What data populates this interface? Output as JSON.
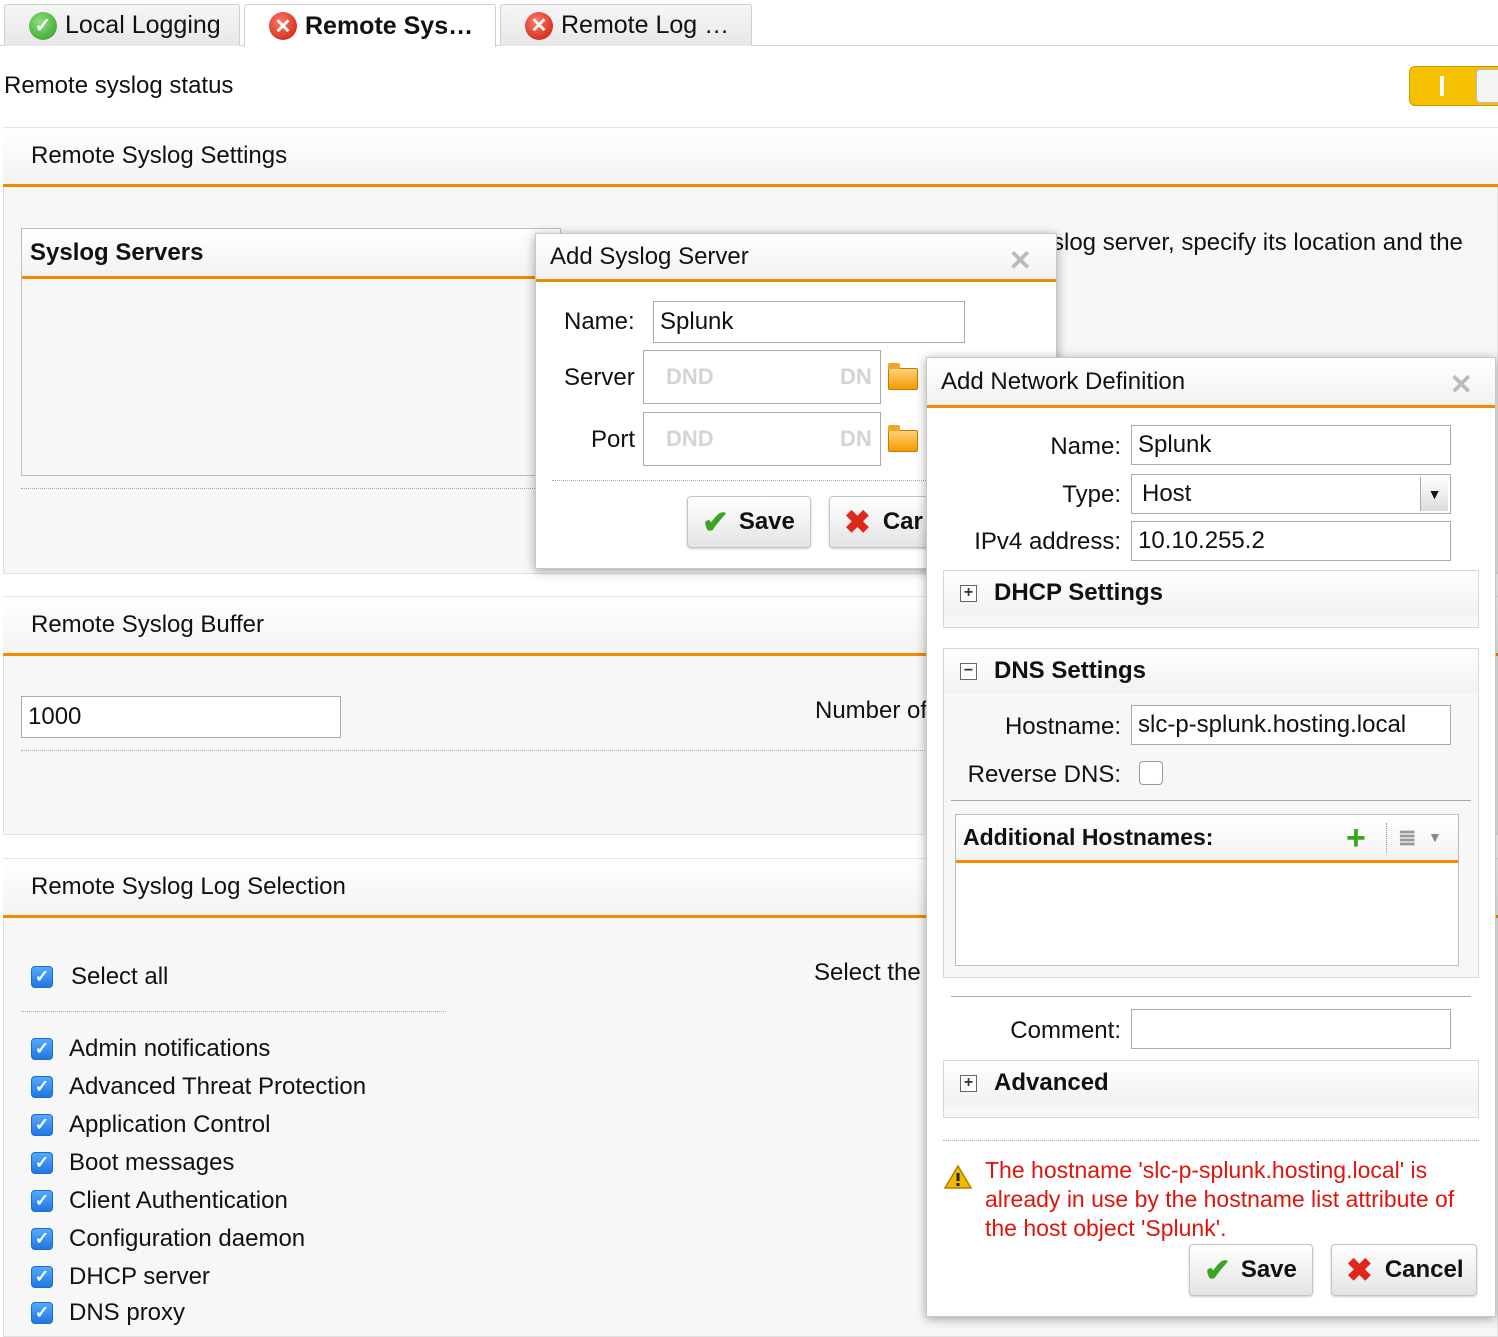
{
  "tabs": [
    {
      "label": "Local Logging",
      "status": "ok"
    },
    {
      "label": "Remote Sys…",
      "status": "error"
    },
    {
      "label": "Remote Log …",
      "status": "error"
    }
  ],
  "status": {
    "label": "Remote syslog status",
    "toggle_on": true
  },
  "settings": {
    "title": "Remote Syslog Settings",
    "servers_title": "Syslog Servers",
    "description_fragment": "slog server, specify its location and the"
  },
  "buffer": {
    "title": "Remote Syslog Buffer",
    "value": "1000",
    "description_fragment": "Number of"
  },
  "log_selection": {
    "title": "Remote Syslog Log Selection",
    "select_all": "Select all",
    "description_fragment": "Select the",
    "items": [
      "Admin notifications",
      "Advanced Threat Protection",
      "Application Control",
      "Boot messages",
      "Client Authentication",
      "Configuration daemon",
      "DHCP server",
      "DNS proxy"
    ]
  },
  "syslog_dialog": {
    "title": "Add Syslog Server",
    "name_label": "Name:",
    "name_value": "Splunk",
    "server_label": "Server",
    "port_label": "Port",
    "placeholder": "DND",
    "placeholder_right": "DN",
    "save": "Save",
    "cancel": "Car"
  },
  "network_dialog": {
    "title": "Add Network Definition",
    "name_label": "Name:",
    "name_value": "Splunk",
    "type_label": "Type:",
    "type_value": "Host",
    "ipv4_label": "IPv4 address:",
    "ipv4_value": "10.10.255.2",
    "dhcp_title": "DHCP Settings",
    "dns_title": "DNS Settings",
    "hostname_label": "Hostname:",
    "hostname_value": "slc-p-splunk.hosting.local",
    "reverse_dns_label": "Reverse DNS:",
    "additional_hostnames": "Additional Hostnames:",
    "comment_label": "Comment:",
    "advanced_title": "Advanced",
    "warning": "The hostname 'slc-p-splunk.hosting.local' is already in use by the hostname list attribute of the host object 'Splunk'.",
    "save": "Save",
    "cancel": "Cancel"
  },
  "colors": {
    "accent": "#f08c00",
    "toggle": "#f5c000",
    "error": "#e0140b",
    "check": "#3aa521"
  },
  "icons": {
    "tab_ok": "check-circle-icon",
    "tab_error": "x-circle-icon",
    "close": "close-icon",
    "folder": "folder-icon",
    "warning": "warning-icon"
  }
}
